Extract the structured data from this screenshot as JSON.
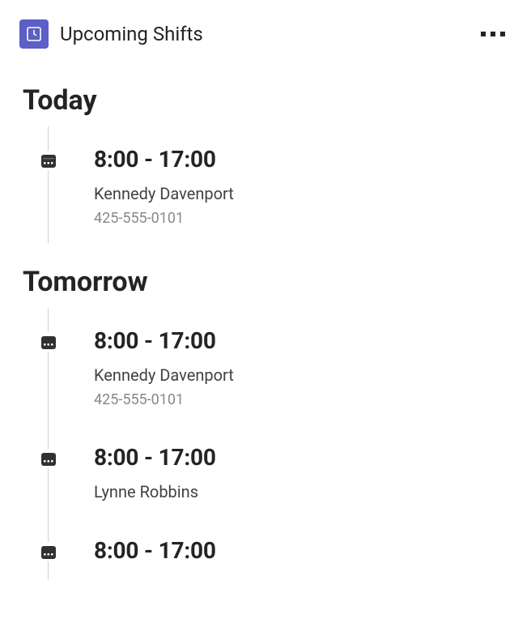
{
  "header": {
    "title": "Upcoming Shifts"
  },
  "sections": [
    {
      "label": "Today",
      "shifts": [
        {
          "time": "8:00 - 17:00",
          "name": "Kennedy Davenport",
          "phone": "425-555-0101"
        }
      ]
    },
    {
      "label": "Tomorrow",
      "shifts": [
        {
          "time": "8:00 - 17:00",
          "name": "Kennedy Davenport",
          "phone": "425-555-0101"
        },
        {
          "time": "8:00 - 17:00",
          "name": "Lynne Robbins"
        },
        {
          "time": "8:00 - 17:00"
        }
      ]
    }
  ]
}
